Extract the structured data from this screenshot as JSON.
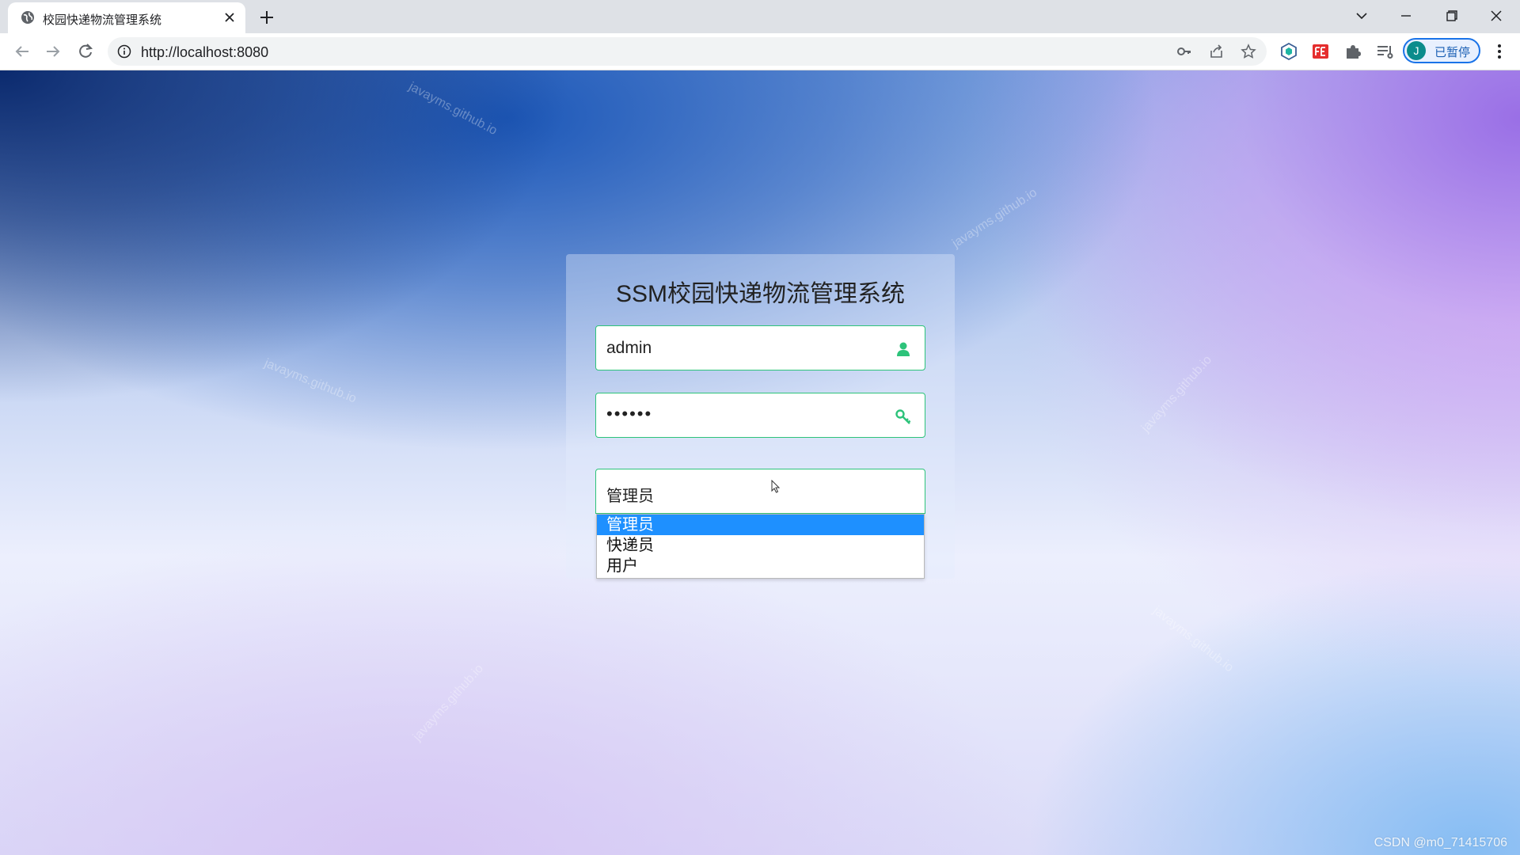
{
  "browser": {
    "tab_title": "校园快递物流管理系统",
    "url": "http://localhost:8080",
    "profile_initial": "J",
    "profile_label": "已暂停"
  },
  "login": {
    "title": "SSM校园快递物流管理系统",
    "username_value": "admin",
    "password_value": "••••••",
    "role_selected": "管理员",
    "role_options": [
      "管理员",
      "快递员",
      "用户"
    ]
  },
  "watermark_text": "javayms.github.io",
  "credit": "CSDN @m0_71415706",
  "colors": {
    "field_border": "#2dc37a",
    "field_icon": "#2dc37a",
    "selected_option": "#1e90ff"
  },
  "icons": [
    "globe-icon",
    "close-icon",
    "plus-icon",
    "back-arrow-icon",
    "forward-arrow-icon",
    "reload-icon",
    "info-icon",
    "key-icon",
    "share-icon",
    "star-icon",
    "extension-hexagon-icon",
    "extension-fe-icon",
    "puzzle-icon",
    "reading-list-icon",
    "more-icon",
    "user-icon",
    "password-key-icon"
  ]
}
